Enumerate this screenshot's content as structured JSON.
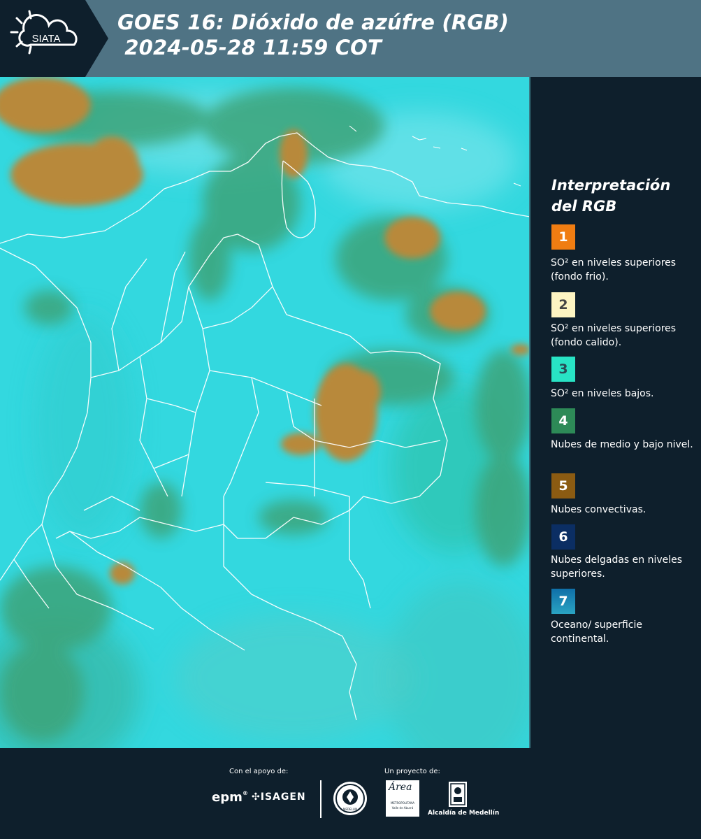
{
  "header": {
    "logo_text": "SIATA",
    "title_line1": "GOES 16: Dióxido de azúfre (RGB)",
    "title_line2": " 2024-05-28 11:59 COT"
  },
  "legend": {
    "title_line1": "Interpretación",
    "title_line2": "del RGB",
    "items": [
      {
        "number": "1",
        "color": "#f07d12",
        "text": "SO² en niveles superiores (fondo frio)."
      },
      {
        "number": "2",
        "color": "#fdf4c2",
        "text": "SO² en niveles superiores (fondo calido)."
      },
      {
        "number": "3",
        "color": "#28e3c5",
        "text": "SO² en niveles bajos."
      },
      {
        "number": "4",
        "color": "#2d8a57",
        "text": "Nubes de medio y bajo nivel."
      },
      {
        "number": "5",
        "color": "#8b5b12",
        "text": "Nubes convectivas."
      },
      {
        "number": "6",
        "color": "#0b2e63",
        "text": "Nubes delgadas en niveles superiores."
      },
      {
        "number": "7",
        "color": "#1b8ab0",
        "text": "Oceano/ superficie continental."
      }
    ]
  },
  "footer": {
    "support_label": "Con el apoyo de:",
    "project_label": "Un proyecto de:",
    "sponsors": [
      "epm",
      "ISAGEN"
    ],
    "partners": [
      "MEDELLIN",
      "Área",
      "METROPOLITANA",
      "Valle de Aburrá",
      "Alcaldía de Medellín"
    ]
  }
}
